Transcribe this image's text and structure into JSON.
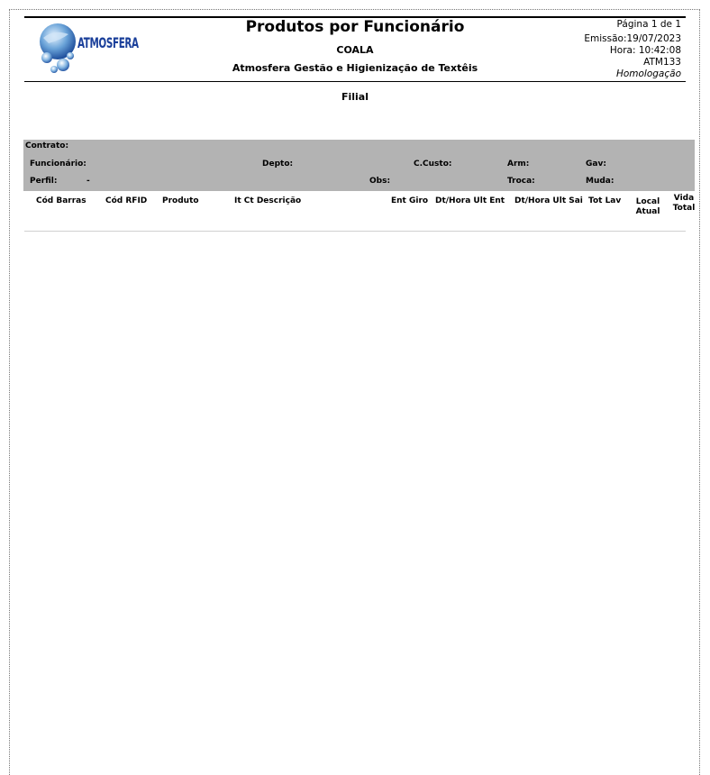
{
  "report": {
    "title": "Produtos por Funcionário",
    "subtitle": "COALA",
    "company": "Atmosfera Gestão e Higienização de Textêis",
    "logo_text": "ATMOSFERA",
    "page": "Página 1 de 1",
    "emissao": "Emissão:19/07/2023",
    "hora": "Hora: 10:42:08",
    "code": "ATM133",
    "environment": "Homologação",
    "filial_label": "Filial"
  },
  "band": {
    "contrato": "Contrato:",
    "funcionario": "Funcionário:",
    "depto": "Depto:",
    "ccusto": "C.Custo:",
    "arm": "Arm:",
    "gav": "Gav:",
    "perfil": "Perfil:",
    "perfil_value": "-",
    "obs": "Obs:",
    "troca": "Troca:",
    "muda": "Muda:"
  },
  "columns": {
    "cod_barras": "Cód Barras",
    "cod_rfid": "Cód RFID",
    "produto": "Produto",
    "it_ct_descricao": "It Ct Descrição",
    "ent_giro": "Ent Giro",
    "dt_hora_ult_ent": "Dt/Hora Ult Ent",
    "dt_hora_ult_sai": "Dt/Hora Ult Sai",
    "tot_lav": "Tot Lav",
    "local_1": "Local",
    "local_2": "Atual",
    "vida_1": "Vida",
    "vida_2": "Total"
  },
  "colors": {
    "band": "#b3b3b3",
    "logo_blue": "#1a3f9a"
  }
}
